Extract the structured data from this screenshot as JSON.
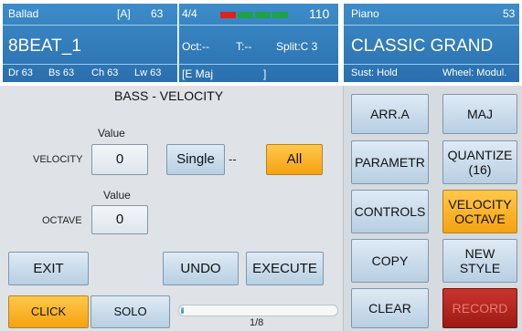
{
  "style_panel": {
    "category": "Ballad",
    "bank": "[A]",
    "number": "63",
    "name": "8BEAT_1",
    "levels": [
      "Dr 63",
      "Bs 63",
      "Ch 63",
      "Lw 63"
    ]
  },
  "status_panel": {
    "time_signature": "4/4",
    "tempo": "110",
    "octave": "Oct:--",
    "transpose": "T:--",
    "split": "Split:C 3",
    "chord": "[E Maj",
    "chord_end": "]",
    "beat_indicator": {
      "active_color": "#e0201e",
      "idle_color": "#1ea24a"
    }
  },
  "voice_panel": {
    "category": "Piano",
    "number": "53",
    "name": "CLASSIC GRAND",
    "sustain": "Sust: Hold",
    "wheel": "Wheel: Modul."
  },
  "editor": {
    "title": "BASS - VELOCITY",
    "velocity": {
      "label": "VELOCITY",
      "value_caption": "Value",
      "value": "0"
    },
    "octave": {
      "label": "OCTAVE",
      "value_caption": "Value",
      "value": "0"
    },
    "single_button": "Single",
    "dash": "--",
    "all_button": "All",
    "exit_button": "EXIT",
    "undo_button": "UNDO",
    "execute_button": "EXECUTE",
    "click_button": "CLICK",
    "solo_button": "SOLO",
    "progress": {
      "label": "1/8",
      "fraction": 0.125
    }
  },
  "side_buttons": {
    "arr": "ARR.A",
    "maj": "MAJ",
    "parametr": "PARAMETR",
    "quantize_line1": "QUANTIZE",
    "quantize_line2": "(16)",
    "controls": "CONTROLS",
    "velocity_line1": "VELOCITY",
    "velocity_line2": "OCTAVE",
    "copy": "COPY",
    "new_style": "NEW STYLE",
    "clear": "CLEAR",
    "record": "RECORD"
  },
  "colors": {
    "header_blue": "#2f7cbd",
    "active_orange": "#f7aa1c",
    "record_red": "#b0231c"
  }
}
